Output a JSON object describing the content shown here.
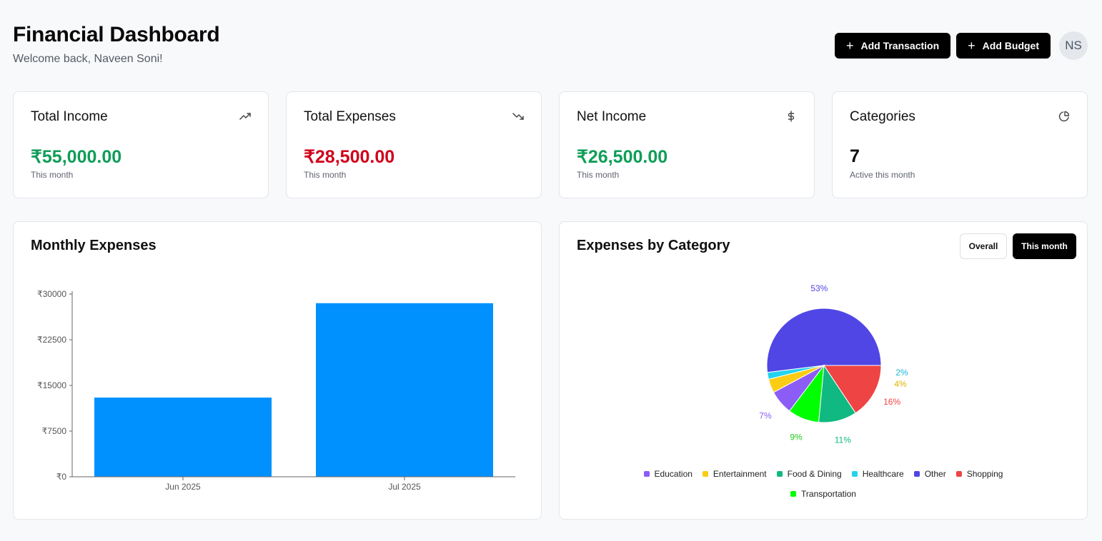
{
  "header": {
    "title": "Financial Dashboard",
    "subtitle": "Welcome back, Naveen Soni!"
  },
  "actions": {
    "add_transaction": "Add Transaction",
    "add_budget": "Add Budget",
    "avatar_initials": "NS"
  },
  "stats": [
    {
      "title": "Total Income",
      "value": "₹55,000.00",
      "note": "This month",
      "icon": "trending-up-icon",
      "color": "#0f9d58"
    },
    {
      "title": "Total Expenses",
      "value": "₹28,500.00",
      "note": "This month",
      "icon": "trending-down-icon",
      "color": "#d0021b"
    },
    {
      "title": "Net Income",
      "value": "₹26,500.00",
      "note": "This month",
      "icon": "dollar-icon",
      "color": "#0f9d58"
    },
    {
      "title": "Categories",
      "value": "7",
      "note": "Active this month",
      "icon": "pie-chart-icon",
      "color": "#0a0a0a"
    }
  ],
  "monthly": {
    "title": "Monthly Expenses"
  },
  "category": {
    "title": "Expenses by Category",
    "toggle_overall": "Overall",
    "toggle_month": "This month"
  },
  "chart_data": [
    {
      "type": "bar",
      "title": "Monthly Expenses",
      "categories": [
        "Jun 2025",
        "Jul 2025"
      ],
      "values": [
        13000,
        28500
      ],
      "ylim": [
        0,
        30000
      ],
      "yticks": [
        "₹0",
        "₹7500",
        "₹15000",
        "₹22500",
        "₹30000"
      ],
      "ytick_values": [
        0,
        7500,
        15000,
        22500,
        30000
      ],
      "color": "#0091ff",
      "grid": false
    },
    {
      "type": "pie",
      "title": "Expenses by Category",
      "slices": [
        {
          "name": "Other",
          "value": 53,
          "label": "53%",
          "color": "#4f46e5"
        },
        {
          "name": "Healthcare",
          "value": 2,
          "label": "2%",
          "color": "#22d3ee"
        },
        {
          "name": "Entertainment",
          "value": 4,
          "label": "4%",
          "color": "#facc15"
        },
        {
          "name": "Education",
          "value": 7,
          "label": "7%",
          "color": "#8b5cf6"
        },
        {
          "name": "Transportation",
          "value": 9,
          "label": "9%",
          "color": "#00ff00"
        },
        {
          "name": "Food & Dining",
          "value": 11,
          "label": "11%",
          "color": "#10b981"
        },
        {
          "name": "Shopping",
          "value": 16,
          "label": "16%",
          "color": "#ef4444"
        }
      ],
      "legend": [
        "Education",
        "Entertainment",
        "Food & Dining",
        "Healthcare",
        "Other",
        "Shopping",
        "Transportation"
      ],
      "legend_placement": "bottom"
    }
  ]
}
